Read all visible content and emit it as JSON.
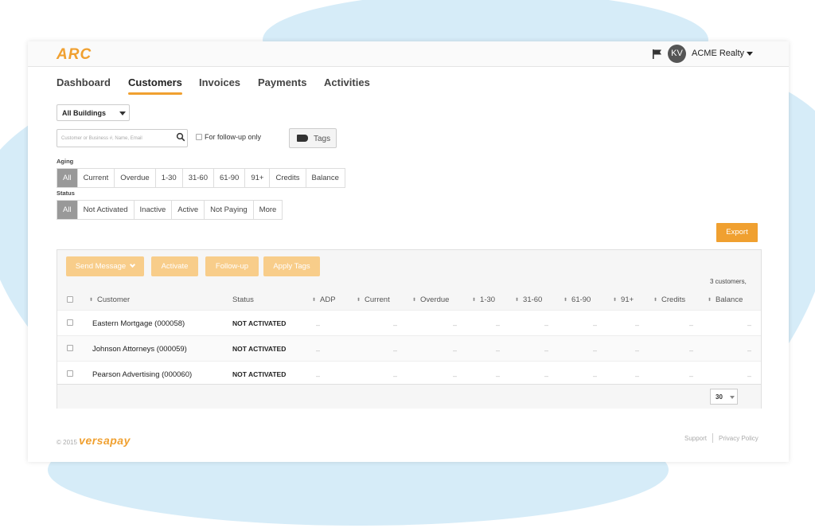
{
  "header": {
    "logo": "ARC",
    "avatar_initials": "KV",
    "account_name": "ACME Realty"
  },
  "nav": {
    "tabs": [
      {
        "label": "Dashboard"
      },
      {
        "label": "Customers",
        "active": true
      },
      {
        "label": "Invoices"
      },
      {
        "label": "Payments"
      },
      {
        "label": "Activities"
      }
    ]
  },
  "filters": {
    "buildings_select": "All Buildings",
    "search_placeholder": "Customer or Business #, Name, Email",
    "follow_up_label": "For follow-up only",
    "tags_label": "Tags",
    "aging_label": "Aging",
    "aging_options": [
      "All",
      "Current",
      "Overdue",
      "1-30",
      "31-60",
      "61-90",
      "91+",
      "Credits",
      "Balance"
    ],
    "aging_selected": "All",
    "status_label": "Status",
    "status_options": [
      "All",
      "Not Activated",
      "Inactive",
      "Active",
      "Not Paying",
      "More"
    ],
    "status_selected": "All"
  },
  "actions": {
    "export_label": "Export",
    "send_message_label": "Send Message",
    "activate_label": "Activate",
    "follow_up_label": "Follow-up",
    "apply_tags_label": "Apply Tags",
    "customer_count": "3 customers,"
  },
  "table": {
    "columns": [
      "Customer",
      "Status",
      "ADP",
      "Current",
      "Overdue",
      "1-30",
      "31-60",
      "61-90",
      "91+",
      "Credits",
      "Balance"
    ],
    "rows": [
      {
        "customer": "Eastern Mortgage (000058)",
        "status": "NOT ACTIVATED"
      },
      {
        "customer": "Johnson Attorneys (000059)",
        "status": "NOT ACTIVATED"
      },
      {
        "customer": "Pearson Advertising (000060)",
        "status": "NOT ACTIVATED"
      }
    ],
    "empty_value": "–",
    "per_page": "30"
  },
  "footer": {
    "copyright": "© 2015",
    "brand": "versapay",
    "support_link": "Support",
    "privacy_link": "Privacy Policy"
  },
  "colors": {
    "accent": "#f0a030",
    "accent_disabled": "#f8cd8a",
    "background_blob": "#d6ecf8"
  }
}
